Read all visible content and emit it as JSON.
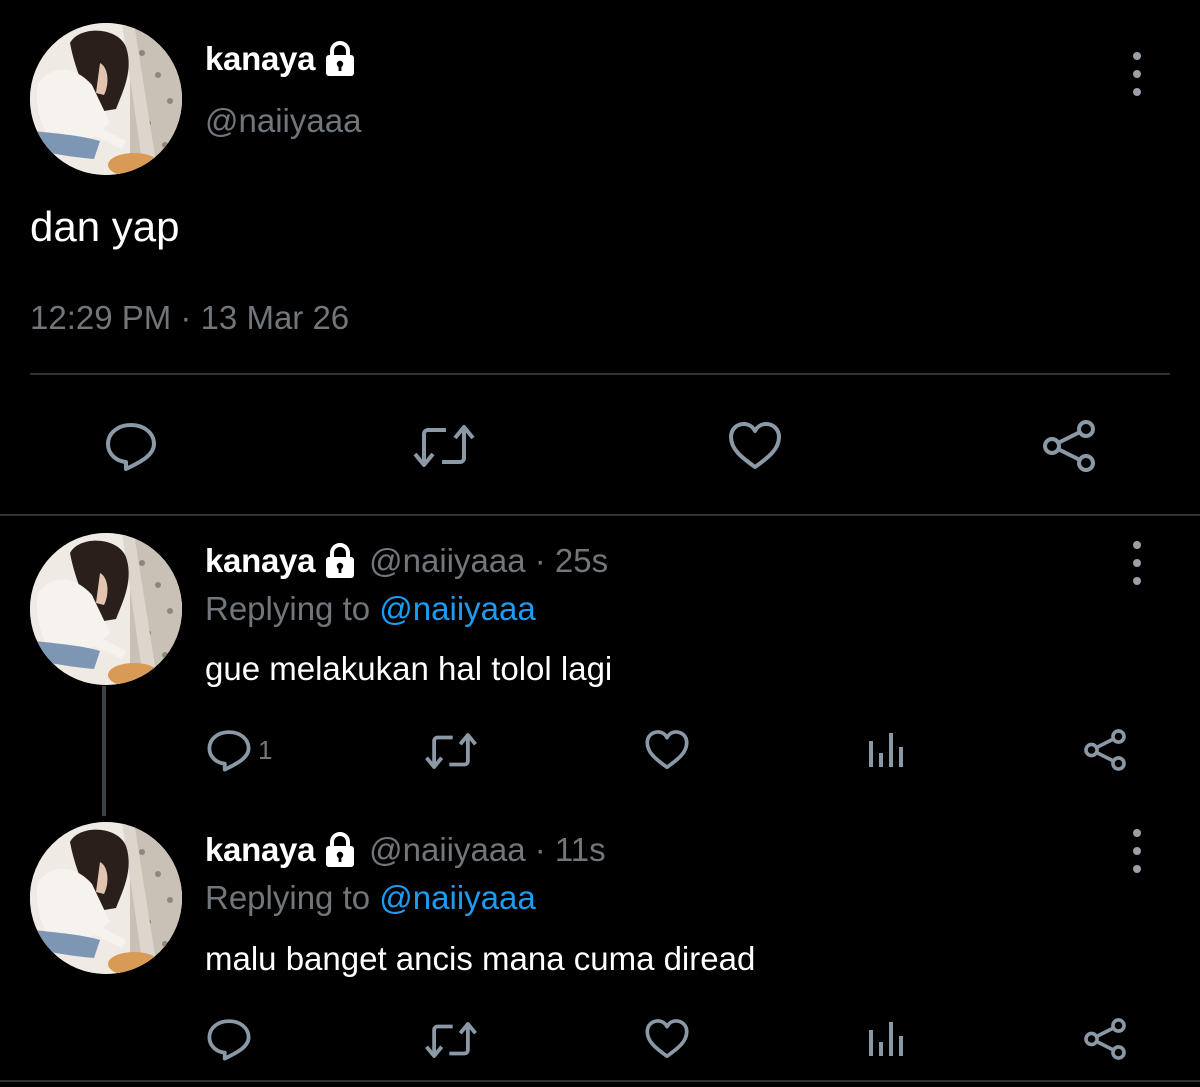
{
  "main_tweet": {
    "display_name": "kanaya",
    "handle": "@naiiyaaa",
    "text": "dan yap",
    "timestamp": "12:29 PM · 13 Mar 26",
    "icons": [
      "lock-icon",
      "more-icon",
      "reply-icon",
      "retweet-icon",
      "like-icon",
      "share-icon"
    ]
  },
  "replies": [
    {
      "display_name": "kanaya",
      "handle": "@naiiyaaa",
      "time_ago": "· 25s",
      "replying_prefix": "Replying to",
      "replying_to": "@naiiyaaa",
      "text": "gue melakukan hal tolol lagi",
      "reply_count": "1"
    },
    {
      "display_name": "kanaya",
      "handle": "@naiiyaaa",
      "time_ago": "· 11s",
      "replying_prefix": "Replying to",
      "replying_to": "@naiiyaaa",
      "text": "malu banget ancis mana cuma diread",
      "reply_count": ""
    }
  ],
  "colors": {
    "background": "#000000",
    "text_primary": "#ffffff",
    "text_secondary": "#71767b",
    "mention": "#1d9bf0",
    "divider": "#2f3336"
  }
}
